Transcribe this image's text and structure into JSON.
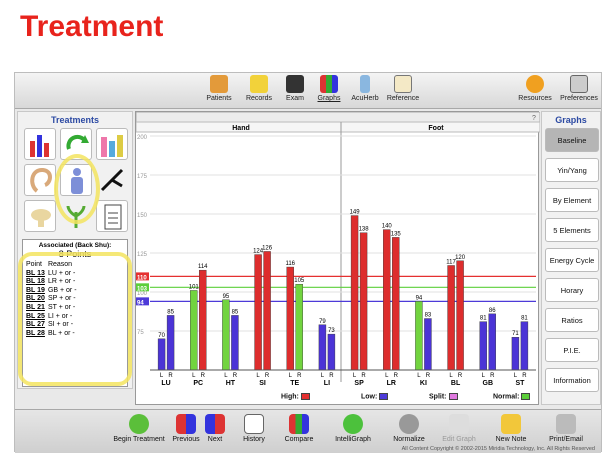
{
  "slide_title": "Treatment",
  "toolbar": {
    "items": [
      {
        "label": "Patients",
        "icon": "patients-icon"
      },
      {
        "label": "Records",
        "icon": "records-icon"
      },
      {
        "label": "Exam",
        "icon": "exam-icon"
      },
      {
        "label": "Graphs",
        "icon": "graphs-icon"
      },
      {
        "label": "AcuHerb",
        "icon": "acuherb-icon"
      },
      {
        "label": "Reference",
        "icon": "reference-icon"
      },
      {
        "label": "Resources",
        "icon": "resources-icon"
      },
      {
        "label": "Preferences",
        "icon": "preferences-icon"
      }
    ]
  },
  "treatments": {
    "title": "Treatments",
    "assoc_title": "Associated (Back Shu):",
    "assoc_count": "8 Points",
    "col_point": "Point",
    "col_reason": "Reason",
    "rows": [
      {
        "point": "BL 13",
        "reason": "LU + or -"
      },
      {
        "point": "BL 18",
        "reason": "LR + or -"
      },
      {
        "point": "BL 19",
        "reason": "GB + or -"
      },
      {
        "point": "BL 20",
        "reason": "SP + or -"
      },
      {
        "point": "BL 21",
        "reason": "ST + or -"
      },
      {
        "point": "BL 25",
        "reason": "LI + or -"
      },
      {
        "point": "BL 27",
        "reason": "SI + or -"
      },
      {
        "point": "BL 28",
        "reason": "BL + or -"
      }
    ]
  },
  "graphs_panel": {
    "title": "Graphs",
    "buttons": [
      "Baseline",
      "Yin/Yang",
      "By Element",
      "5 Elements",
      "Energy Cycle",
      "Horary",
      "Ratios",
      "P.I.E.",
      "Information"
    ]
  },
  "chart_data": {
    "type": "bar",
    "header_question": "?",
    "section_labels": [
      "Hand",
      "Foot"
    ],
    "ylim": [
      50,
      200
    ],
    "yticks": [
      200,
      175,
      150,
      125,
      100,
      75
    ],
    "reference_lines": {
      "high": 110,
      "mid": 103,
      "low": 94
    },
    "meridians": [
      "LU",
      "PC",
      "HT",
      "SI",
      "TE",
      "LI",
      "SP",
      "LR",
      "KI",
      "BL",
      "GB",
      "ST"
    ],
    "side_labels": [
      "L",
      "R"
    ],
    "series": [
      {
        "name": "L",
        "values": [
          70,
          101,
          95,
          124,
          116,
          79,
          149,
          140,
          94,
          117,
          81,
          71
        ]
      },
      {
        "name": "R",
        "values": [
          85,
          114,
          85,
          126,
          105,
          73,
          138,
          135,
          83,
          120,
          86,
          81
        ]
      }
    ],
    "colors": {
      "blue": "#4b34d6",
      "green": "#72d43f",
      "red": "#dd2d2d",
      "high_line": "#e53030",
      "mid_line": "#5ccf3a",
      "low_line": "#4d3ad8"
    },
    "legend": [
      {
        "label": "High:",
        "color": "#e53030"
      },
      {
        "label": "Low:",
        "color": "#4d3ad8"
      },
      {
        "label": "Split:",
        "color": "#e07ae0"
      },
      {
        "label": "Normal:",
        "color": "#5ccf3a"
      }
    ]
  },
  "bottom": {
    "items": [
      "Begin Treatment",
      "Previous",
      "Next",
      "History",
      "Compare",
      "IntelliGraph",
      "Normalize",
      "Edit Graph",
      "New Note",
      "Print/Email"
    ],
    "copyright": "All Content Copyright © 2002-2015 Miridia Technology, Inc. All Rights Reserved"
  }
}
